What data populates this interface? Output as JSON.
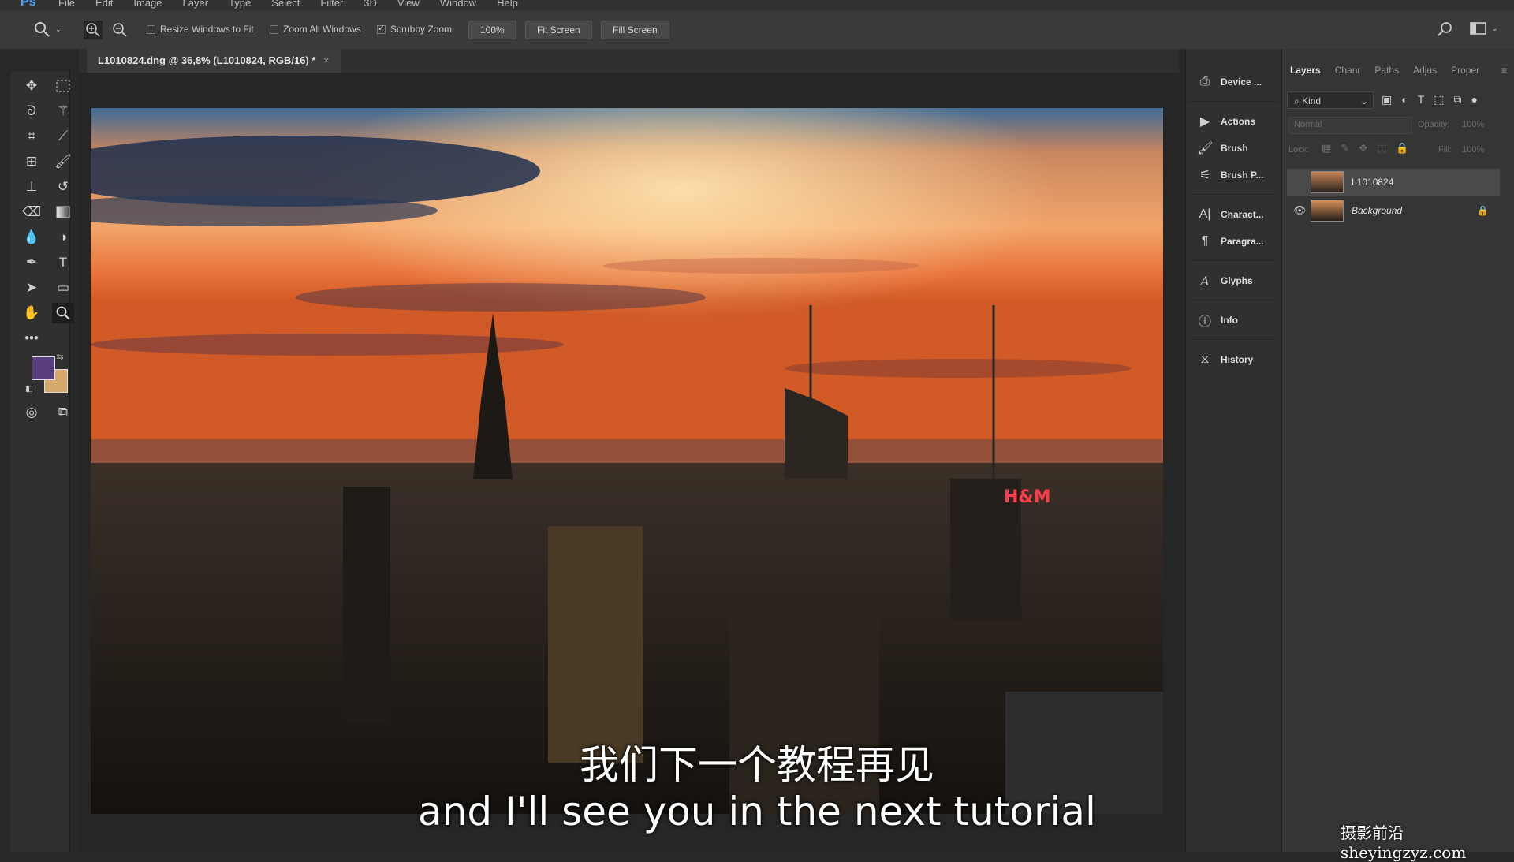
{
  "app": {
    "logo": "Ps",
    "menus": [
      "File",
      "Edit",
      "Image",
      "Layer",
      "Type",
      "Select",
      "Filter",
      "3D",
      "View",
      "Window",
      "Help"
    ]
  },
  "options": {
    "resize_windows": "Resize Windows to Fit",
    "zoom_all": "Zoom All Windows",
    "scrubby": "Scrubby Zoom",
    "zoom_value": "100%",
    "fit_screen": "Fit Screen",
    "fill_screen": "Fill Screen"
  },
  "document": {
    "tab_title": "L1010824.dng @ 36,8% (L1010824, RGB/16) *"
  },
  "subtitles": {
    "chinese": "我们下一个教程再见",
    "english": "and I'll see you in the next tutorial"
  },
  "dock": [
    "Device ...",
    "Actions",
    "Brush",
    "Brush P...",
    "Charact...",
    "Paragra...",
    "Glyphs",
    "Info",
    "History"
  ],
  "layers_panel": {
    "tabs": [
      "Layers",
      "Chanr",
      "Paths",
      "Adjus",
      "Proper"
    ],
    "filter": "Kind",
    "blend_mode": "Normal",
    "opacity_label": "Opacity:",
    "opacity_value": "100%",
    "lock_label": "Lock:",
    "fill_label": "Fill:",
    "fill_value": "100%",
    "layers": [
      {
        "name": "L1010824",
        "selected": true,
        "visible": false
      },
      {
        "name": "Background",
        "selected": false,
        "visible": true
      }
    ]
  },
  "watermark": "摄影前沿 sheyingzyz.com",
  "colors": {
    "foreground": "#5a3f7e",
    "background": "#d6a86a"
  }
}
